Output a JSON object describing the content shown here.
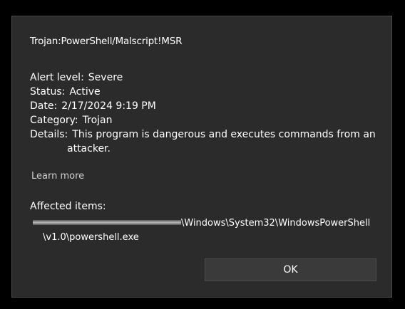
{
  "threat": {
    "name": "Trojan:PowerShell/Malscript!MSR"
  },
  "details": {
    "alert_level_label": "Alert level:",
    "alert_level_value": "Severe",
    "status_label": "Status:",
    "status_value": "Active",
    "date_label": "Date:",
    "date_value": "2/17/2024 9:19 PM",
    "category_label": "Category:",
    "category_value": "Trojan",
    "details_label": "Details:",
    "details_value_line1": "This program is dangerous and executes commands from an",
    "details_value_line2": "attacker."
  },
  "learn_more": "Learn more",
  "affected": {
    "title": "Affected items:",
    "path_line1": "\\Windows\\System32\\WindowsPowerShell",
    "path_line2": "\\v1.0\\powershell.exe"
  },
  "buttons": {
    "ok_label": "OK"
  },
  "colors": {
    "background": "#000000",
    "dialog": "#2b2b2b",
    "button": "#3a3a3a"
  }
}
